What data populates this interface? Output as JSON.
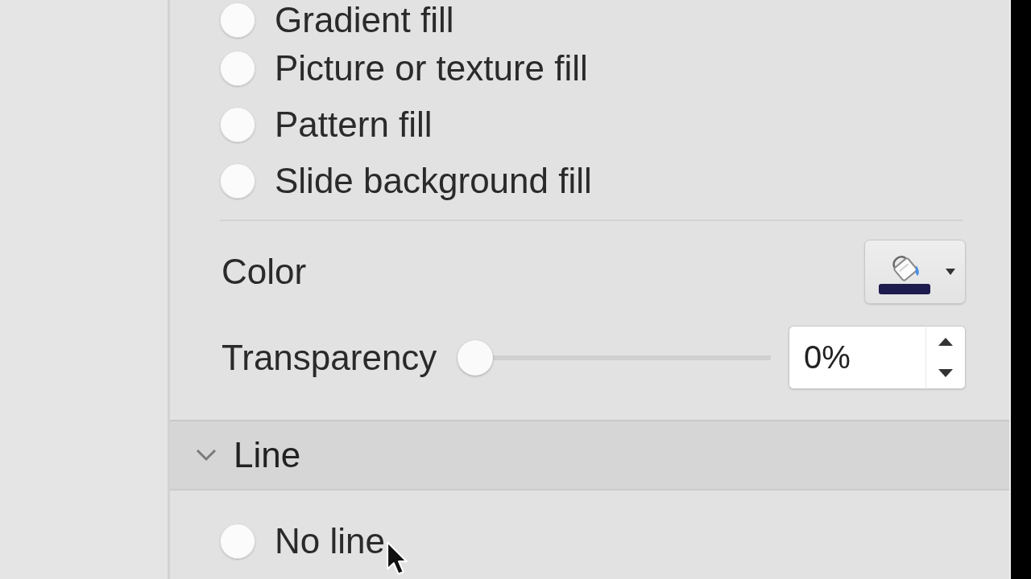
{
  "fill_options": [
    {
      "label": "Gradient fill",
      "selected": false
    },
    {
      "label": "Picture or texture fill",
      "selected": false
    },
    {
      "label": "Pattern fill",
      "selected": false
    },
    {
      "label": "Slide background fill",
      "selected": false
    }
  ],
  "color": {
    "label": "Color",
    "color": "#1e1b4f"
  },
  "transparency": {
    "label": "Transparency",
    "level": 0,
    "value": "0%"
  },
  "line_section": {
    "title": "Line",
    "expanded": true,
    "options": [
      {
        "label": "No line",
        "selected": false
      }
    ]
  }
}
